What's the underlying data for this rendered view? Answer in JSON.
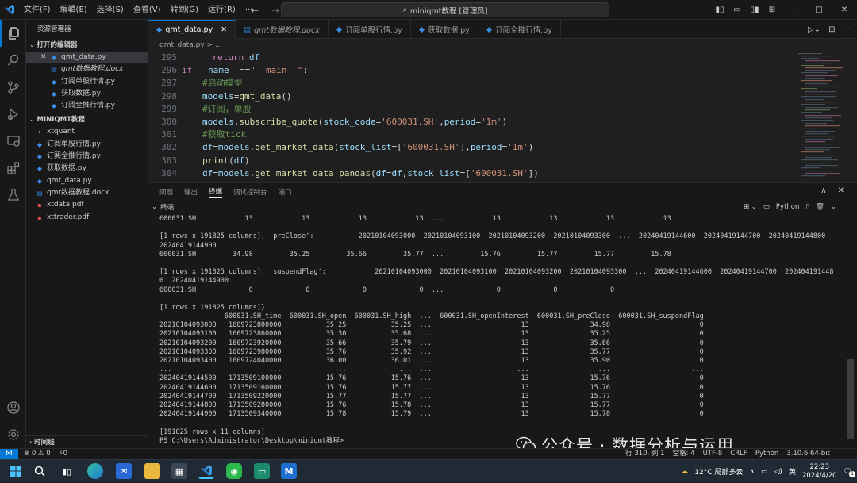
{
  "titlebar": {
    "menus": [
      "文件(F)",
      "编辑(E)",
      "选择(S)",
      "查看(V)",
      "转到(G)",
      "运行(R)",
      "···"
    ],
    "command_center": "miniqmt教程 [管理员]"
  },
  "sidebar": {
    "title": "资源管理器",
    "open_editors_header": "打开的编辑器",
    "open_editors": [
      {
        "close": "✕",
        "label": "qmt_data.py",
        "type": "py"
      },
      {
        "label": "qmt数据教程.docx",
        "type": "doc"
      },
      {
        "label": "订阅单股行情.py",
        "type": "py"
      },
      {
        "label": "获取数据.py",
        "type": "py"
      },
      {
        "label": "订阅全推行情.py",
        "type": "py"
      }
    ],
    "folder_header": "MINIQMT教程",
    "files": [
      {
        "label": "xtquant",
        "type": "folder"
      },
      {
        "label": "订阅单股行情.py",
        "type": "py"
      },
      {
        "label": "订阅全推行情.py",
        "type": "py"
      },
      {
        "label": "获取数据.py",
        "type": "py"
      },
      {
        "label": "qmt_data.py",
        "type": "py"
      },
      {
        "label": "qmt数据教程.docx",
        "type": "doc"
      },
      {
        "label": "xtdata.pdf",
        "type": "pdf"
      },
      {
        "label": "xttrader.pdf",
        "type": "pdf"
      }
    ],
    "timeline_header": "时间线"
  },
  "editor": {
    "tabs": [
      {
        "label": "qmt_data.py"
      },
      {
        "label": "qmt数据教程.docx"
      },
      {
        "label": "订阅单股行情.py"
      },
      {
        "label": "获取数据.py"
      },
      {
        "label": "订阅全推行情.py"
      }
    ],
    "breadcrumb": "qmt_data.py > ...",
    "line_numbers": [
      "295",
      "296",
      "297",
      "298",
      "299",
      "300",
      "301",
      "302",
      "303",
      "304"
    ]
  },
  "panel": {
    "tabs": [
      "问题",
      "输出",
      "终端",
      "调试控制台",
      "端口"
    ],
    "terminal_label": "终端",
    "terminal_profile": "Python",
    "terminal_lines": [
      "600031.SH            13            13            13            13  ...            13            13            13            13",
      "",
      "[1 rows x 191825 columns], 'preClose':           20210104093000  20210104093100  20210104093200  20210104093300  ...  20240419144600  20240419144700  20240419144800",
      "20240419144900",
      "600031.SH         34.98         35.25         35.66         35.77  ...         15.76         15.77         15.77         15.78",
      "",
      "[1 rows x 191825 columns], 'suspendFlag':            20210104093000  20210104093100  20210104093200  20210104093300  ...  20240419144600  20240419144700  202404191448",
      "0  20240419144900",
      "600031.SH             0             0             0             0  ...             0             0             0",
      "",
      "[1 rows x 191825 columns]}",
      "                600031.SH_time  600031.SH_open  600031.SH_high  ...  600031.SH_openInterest  600031.SH_preClose  600031.SH_suspendFlag",
      "20210104093000   1609723800000           35.25           35.25  ...                      13               34.98                      0",
      "20210104093100   1609723860000           35.30           35.68  ...                      13               35.25                      0",
      "20210104093200   1609723920000           35.66           35.79  ...                      13               35.66                      0",
      "20210104093300   1609723980000           35.76           35.92  ...                      13               35.77                      0",
      "20210104093400   1609724040000           36.00           36.01  ...                      13               35.90                      0",
      "...                        ...             ...             ...  ...                     ...                 ...                    ...",
      "20240419144500   1713509100000           15.76           15.76  ...                      13               15.76                      0",
      "20240419144600   1713509160000           15.76           15.77  ...                      13               15.76                      0",
      "20240419144700   1713509220000           15.77           15.77  ...                      13               15.77                      0",
      "20240419144800   1713509280000           15.76           15.78  ...                      13               15.77                      0",
      "20240419144900   1713509340000           15.78           15.79  ...                      13               15.78                      0",
      "",
      "[191825 rows x 11 columns]",
      "PS C:\\Users\\Administrator\\Desktop\\miniqmt教程>"
    ]
  },
  "statusbar": {
    "errors": "⊗ 0 ⚠ 0",
    "ports": "⚡0",
    "position": "行 310, 列 1",
    "spaces": "空格: 4",
    "encoding": "UTF-8",
    "eol": "CRLF",
    "language": "Python",
    "interpreter": "3.10.6 64-bit"
  },
  "watermark": "公众号 · 数据分析与运用",
  "taskbar": {
    "weather": "12°C 局部多云",
    "ime": "英",
    "time": "22:23",
    "date": "2024/4/20",
    "notifications": "1"
  },
  "colors": {
    "accent": "#0078d4",
    "keyword": "#c586c0",
    "string": "#ce9178",
    "comment": "#6a9955",
    "function": "#dcdcaa"
  }
}
